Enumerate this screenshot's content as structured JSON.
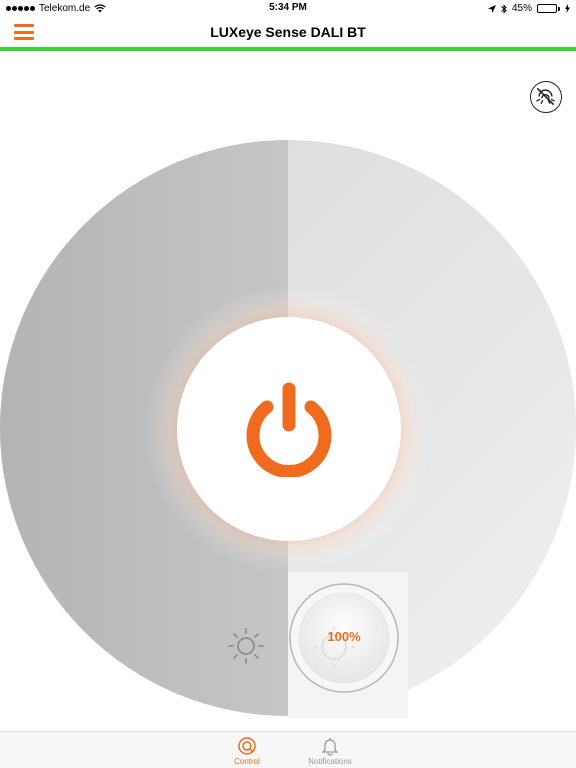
{
  "status_bar": {
    "carrier": "Telekom.de",
    "time": "5:34 PM",
    "battery_percent": "45%",
    "battery_level": 0.45
  },
  "nav": {
    "title": "LUXeye Sense DALI BT",
    "menu_icon": "hamburger-menu-icon"
  },
  "control": {
    "sensor_icon": "sensor-disabled-icon",
    "power_icon": "power-icon",
    "dim_value": "100%",
    "dim_level": 1.0,
    "brightness_icon": "sun-icon"
  },
  "tabs": [
    {
      "label": "Control",
      "icon": "control-icon",
      "active": true
    },
    {
      "label": "Notifications",
      "icon": "bell-icon",
      "active": false
    }
  ],
  "colors": {
    "accent": "#f06b1e",
    "nav_underline": "#35d838",
    "battery": "#4cd964"
  }
}
